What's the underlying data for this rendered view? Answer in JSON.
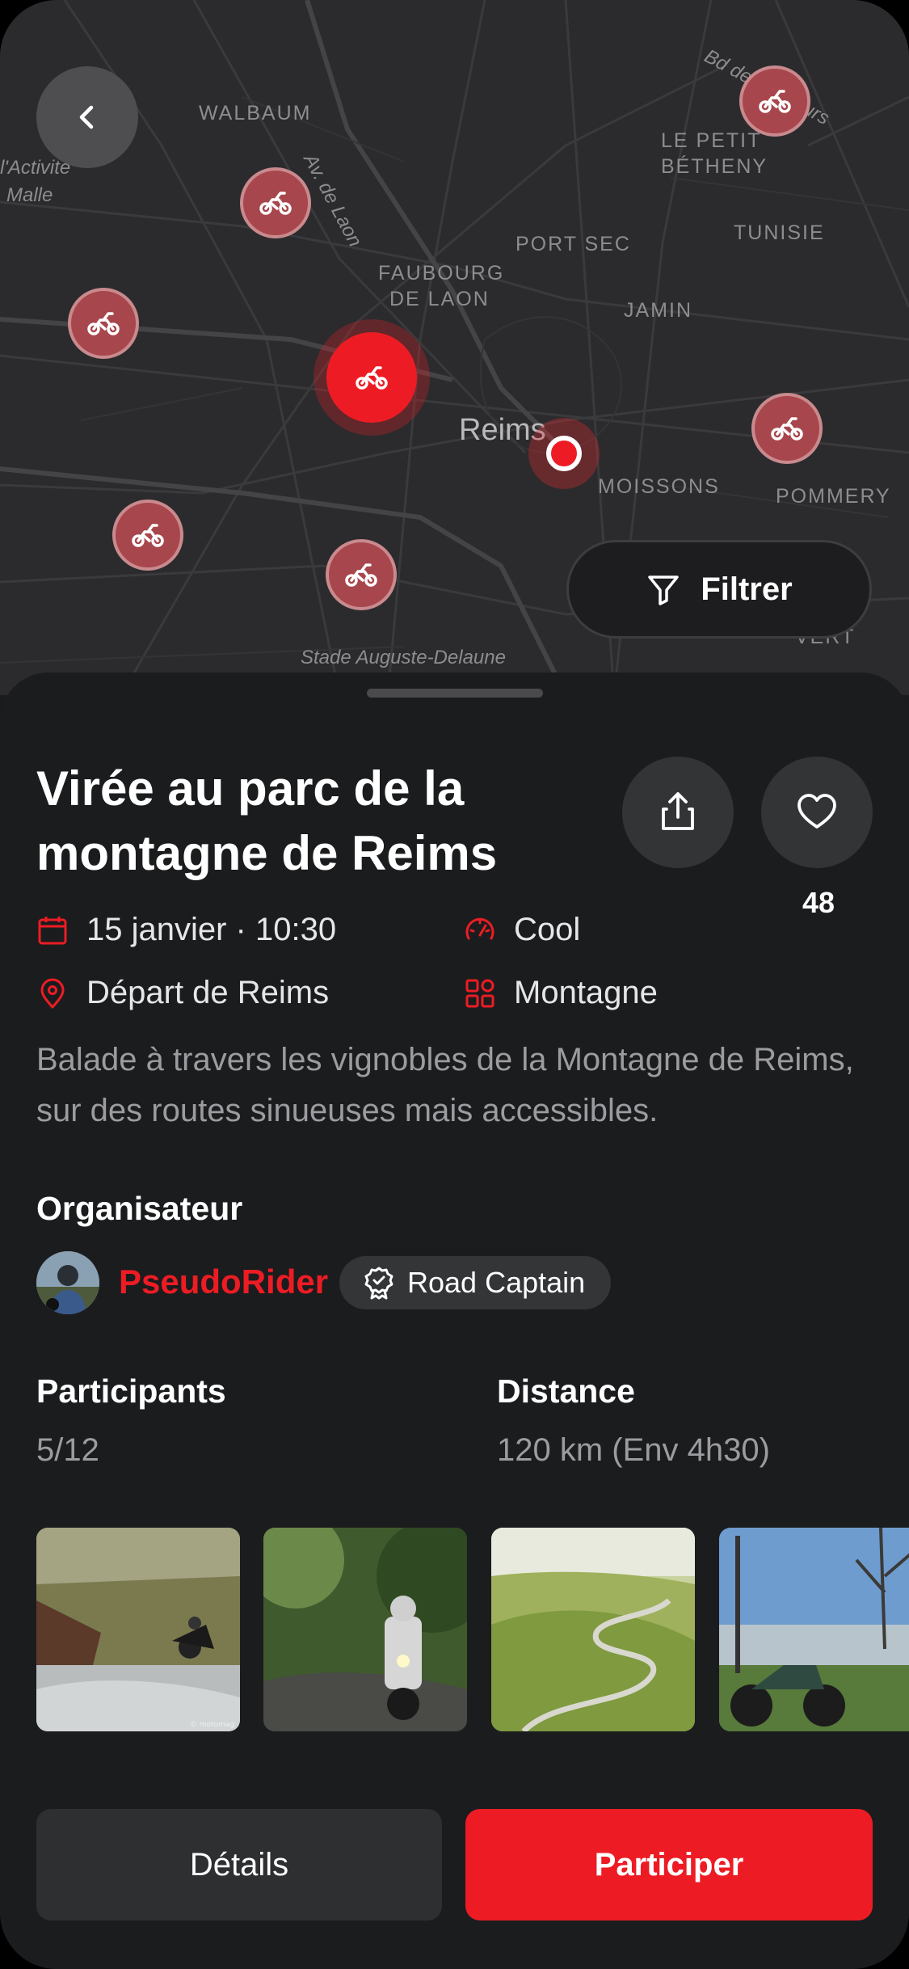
{
  "map": {
    "labels": {
      "walbaum": "WALBAUM",
      "activite": "l'Activité",
      "malle": "Malle",
      "av_laon": "Av. de Laon",
      "bd": "Bd des Buffeurs",
      "le_petit": "LE PETIT",
      "betheny": "BÉTHENY",
      "tunisie": "TUNISIE",
      "port_sec": "PORT SEC",
      "faubourg": "FAUBOURG",
      "de_laon": "DE LAON",
      "jamin": "JAMIN",
      "reims": "Reims",
      "moissons": "MOISSONS",
      "pommery": "POMMERY",
      "stade": "Stade Auguste-Delaune",
      "vert": "VERT"
    },
    "marker_icon": "motorcycle-icon",
    "filter_label": "Filtrer",
    "filter_icon": "filter-icon",
    "back_icon": "chevron-left-icon"
  },
  "event": {
    "title": "Virée au parc de la montagne de Reims",
    "likes": "48",
    "date": "15 janvier · 10:30",
    "level": "Cool",
    "departure": "Départ de Reims",
    "category": "Montagne",
    "description": "Balade à travers les vignobles de la Montagne de Reims, sur des routes sinueuses mais accessibles."
  },
  "organizer": {
    "section_label": "Organisateur",
    "name": "PseudoRider",
    "badge": "Road Captain"
  },
  "stats": {
    "participants_label": "Participants",
    "participants_value": "5/12",
    "distance_label": "Distance",
    "distance_value": "120 km (Env 4h30)"
  },
  "photos": [
    {
      "watermark": "© motomag"
    }
  ],
  "actions": {
    "details": "Détails",
    "join": "Participer"
  },
  "colors": {
    "accent": "#ed1c24",
    "background": "#1b1c1e",
    "map": "#2b2b2d"
  }
}
